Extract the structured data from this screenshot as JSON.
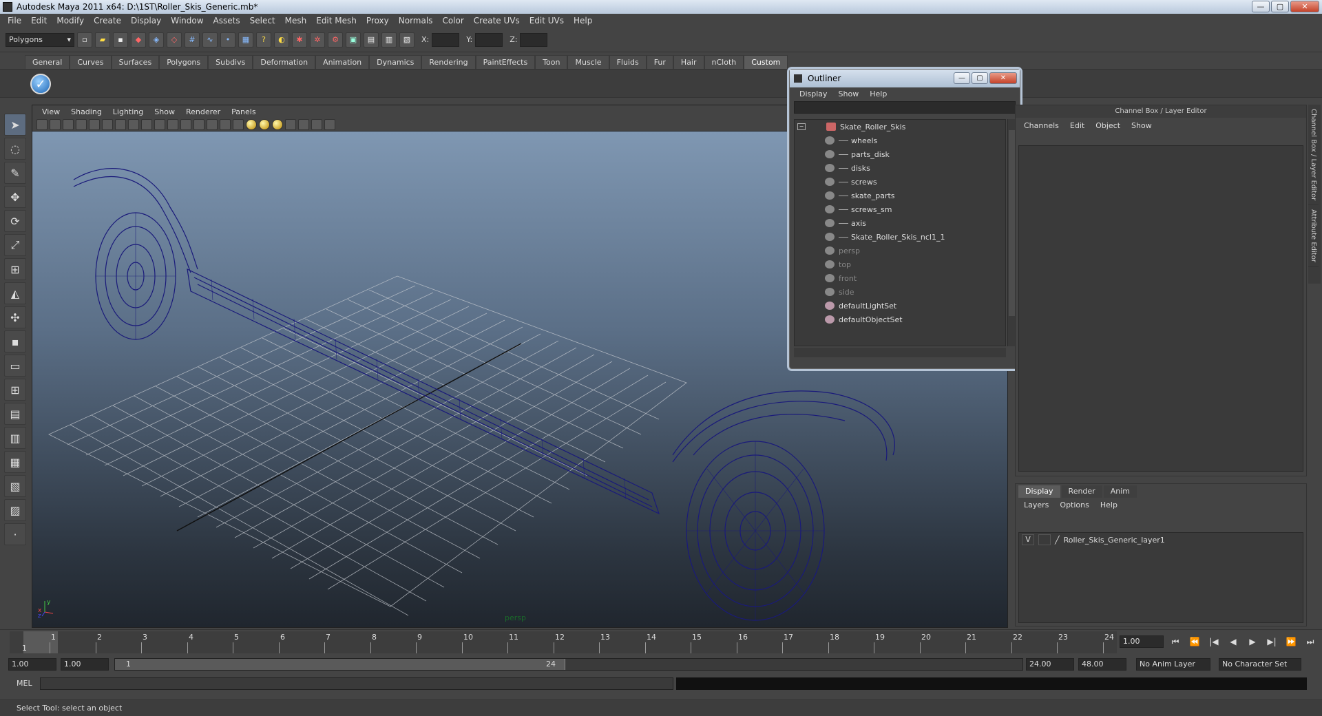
{
  "window": {
    "title": "Autodesk Maya 2011 x64: D:\\1ST\\Roller_Skis_Generic.mb*",
    "minimize": "—",
    "maximize": "▢",
    "close": "✕"
  },
  "menubar": [
    "File",
    "Edit",
    "Modify",
    "Create",
    "Display",
    "Window",
    "Assets",
    "Select",
    "Mesh",
    "Edit Mesh",
    "Proxy",
    "Normals",
    "Color",
    "Create UVs",
    "Edit UVs",
    "Help"
  ],
  "statusline": {
    "mode": "Polygons",
    "x_label": "X:",
    "y_label": "Y:",
    "z_label": "Z:"
  },
  "shelf": {
    "tabs": [
      "General",
      "Curves",
      "Surfaces",
      "Polygons",
      "Subdivs",
      "Deformation",
      "Animation",
      "Dynamics",
      "Rendering",
      "PaintEffects",
      "Toon",
      "Muscle",
      "Fluids",
      "Fur",
      "Hair",
      "nCloth",
      "Custom"
    ],
    "active": "Custom"
  },
  "viewport": {
    "menus": [
      "View",
      "Shading",
      "Lighting",
      "Show",
      "Renderer",
      "Panels"
    ],
    "camera": "persp",
    "axis_y": "y",
    "axis_x": "x",
    "axis_z": "z",
    "wire_color": "#1a1a7a"
  },
  "outliner": {
    "title": "Outliner",
    "menus": [
      "Display",
      "Show",
      "Help"
    ],
    "root": "Skate_Roller_Skis",
    "children": [
      "wheels",
      "parts_disk",
      "disks",
      "screws",
      "skate_parts",
      "screws_sm",
      "axis",
      "Skate_Roller_Skis_ncl1_1"
    ],
    "cameras": [
      "persp",
      "top",
      "front",
      "side"
    ],
    "sets": [
      "defaultLightSet",
      "defaultObjectSet"
    ]
  },
  "channelbox": {
    "title": "Channel Box / Layer Editor",
    "menus": [
      "Channels",
      "Edit",
      "Object",
      "Show"
    ]
  },
  "layers": {
    "tabs": [
      "Display",
      "Render",
      "Anim"
    ],
    "active": "Display",
    "menus": [
      "Layers",
      "Options",
      "Help"
    ],
    "rows": [
      {
        "visible": "V",
        "name": "Roller_Skis_Generic_layer1"
      }
    ]
  },
  "sidetabs": [
    "Channel Box / Layer Editor",
    "Attribute Editor"
  ],
  "timeline": {
    "frames": [
      "1",
      "2",
      "3",
      "4",
      "5",
      "6",
      "7",
      "8",
      "9",
      "10",
      "11",
      "12",
      "13",
      "14",
      "15",
      "16",
      "17",
      "18",
      "19",
      "20",
      "21",
      "22",
      "23",
      "24"
    ],
    "current_frame": "1.00",
    "current_marker": "1",
    "play_buttons": [
      "⏮",
      "⏪",
      "|◀",
      "◀",
      "▶",
      "▶|",
      "⏩",
      "⏭"
    ]
  },
  "range": {
    "start": "1.00",
    "range_start": "1.00",
    "slider_start": "1",
    "slider_end": "24",
    "range_end": "24.00",
    "end": "48.00",
    "anim_layer": "No Anim Layer",
    "char_set": "No Character Set"
  },
  "mel": {
    "label": "MEL"
  },
  "help": {
    "text": "Select Tool: select an object"
  }
}
